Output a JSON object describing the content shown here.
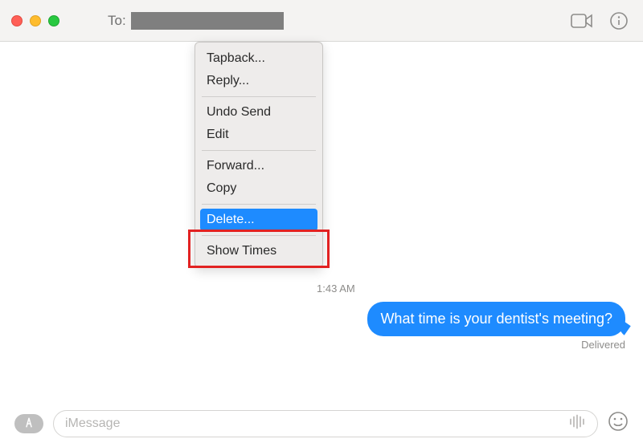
{
  "header": {
    "to_label": "To:"
  },
  "context_menu": {
    "items": {
      "tapback": "Tapback...",
      "reply": "Reply...",
      "undo_send": "Undo Send",
      "edit": "Edit",
      "forward": "Forward...",
      "copy": "Copy",
      "delete": "Delete...",
      "show_times": "Show Times"
    },
    "highlighted": "delete"
  },
  "conversation": {
    "timestamp": "1:43 AM",
    "outgoing_message": "What time is your dentist's meeting?",
    "status": "Delivered"
  },
  "compose": {
    "placeholder": "iMessage"
  }
}
